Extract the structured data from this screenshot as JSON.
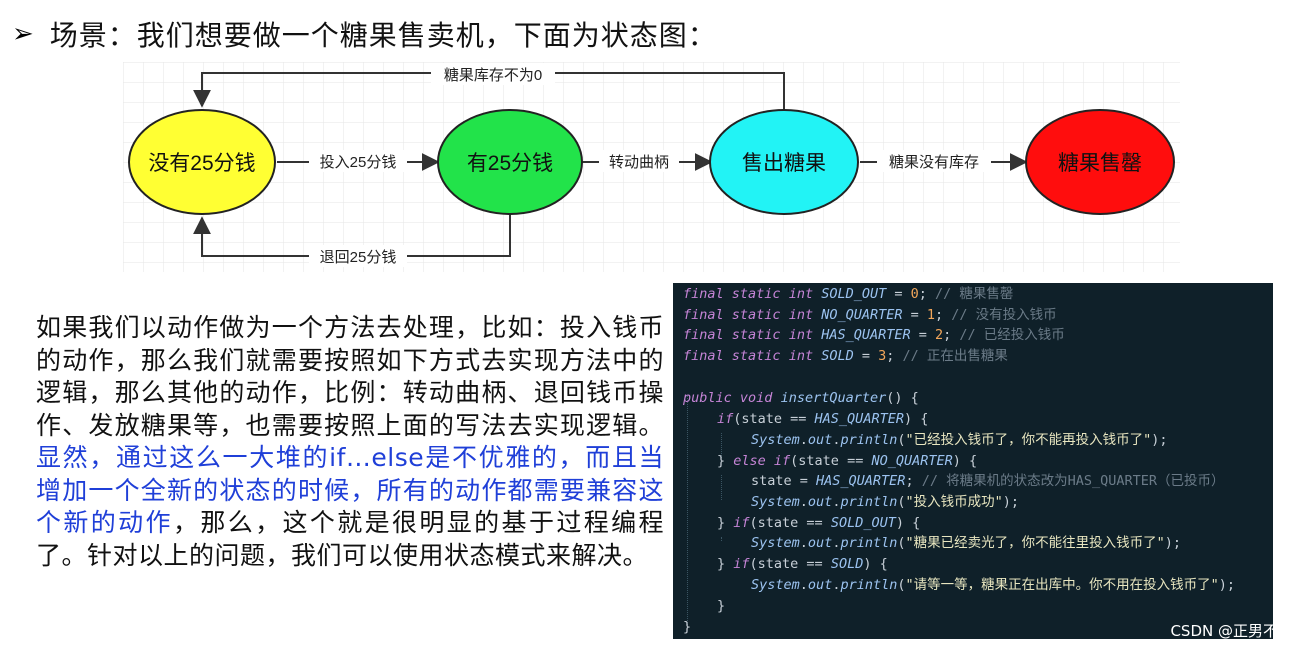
{
  "heading": {
    "bullet": "➢",
    "text": "场景：我们想要做一个糖果售卖机，下面为状态图："
  },
  "diagram": {
    "states": [
      {
        "label": "没有25分钱",
        "fill": "#ffff33"
      },
      {
        "label": "有25分钱",
        "fill": "#22e34a"
      },
      {
        "label": "售出糖果",
        "fill": "#22f3f5"
      },
      {
        "label": "糖果售罄",
        "fill": "#ff0d0d"
      }
    ],
    "transitions": {
      "insert": "投入25分钱",
      "turn": "转动曲柄",
      "sold_out": "糖果没有库存",
      "refund": "退回25分钱",
      "back": "糖果库存不为0"
    }
  },
  "paragraph": {
    "part1": "如果我们以动作做为一个方法去处理，比如：投入钱币的动作，那么我们就需要按照如下方式去实现方法中的逻辑，那么其他的动作，比例：转动曲柄、退回钱币操作、发放糖果等，也需要按照上面的写法去实现逻辑。",
    "highlight": "显然，通过这么一大堆的if…else是不优雅的，而且当增加一个全新的状态的时候，所有的动作都需要兼容这个新的动作",
    "part2": "，那么，这个就是很明显的基于过程编程了。针对以上的问题，我们可以使用状态模式来解决。"
  },
  "code": {
    "line1": {
      "mod": "final static",
      "type": "int",
      "name": "SOLD_OUT",
      "eq": " = ",
      "val": "0",
      "semi": ";",
      "cm": " // 糖果售罄"
    },
    "line2": {
      "mod": "final static",
      "type": "int",
      "name": "NO_QUARTER",
      "eq": " = ",
      "val": "1",
      "semi": ";",
      "cm": " // 没有投入钱币"
    },
    "line3": {
      "mod": "final static",
      "type": "int",
      "name": "HAS_QUARTER",
      "eq": " = ",
      "val": "2",
      "semi": ";",
      "cm": " // 已经投入钱币"
    },
    "line4": {
      "mod": "final static",
      "type": "int",
      "name": "SOLD",
      "eq": " = ",
      "val": "3",
      "semi": ";",
      "cm": " // 正在出售糖果"
    },
    "line5": {
      "mod": "public",
      "type": "void",
      "fn": "insertQuarter",
      "rest": "() {"
    },
    "line6": {
      "kw": "if",
      "open": "(state == ",
      "c": "HAS_QUARTER",
      "close": ") {"
    },
    "line7": {
      "obj": "System",
      "dot1": ".",
      "fld": "out",
      "dot2": ".",
      "fn": "println",
      "open": "(",
      "s": "\"已经投入钱币了，你不能再投入钱币了\"",
      "close": ");"
    },
    "line8": {
      "pre": "} ",
      "kw": "else if",
      "open": "(state == ",
      "c": "NO_QUARTER",
      "close": ") {"
    },
    "line9": {
      "pre": "state = ",
      "c": "HAS_QUARTER",
      "semi": ";",
      "cm": " // 将糖果机的状态改为HAS_QUARTER（已投币）"
    },
    "line10": {
      "obj": "System",
      "dot1": ".",
      "fld": "out",
      "dot2": ".",
      "fn": "println",
      "open": "(",
      "s": "\"投入钱币成功\"",
      "close": ");"
    },
    "line11": {
      "pre": "} ",
      "kw": "if",
      "open": "(state == ",
      "c": "SOLD_OUT",
      "close": ") {"
    },
    "line12": {
      "obj": "System",
      "dot1": ".",
      "fld": "out",
      "dot2": ".",
      "fn": "println",
      "open": "(",
      "s": "\"糖果已经卖光了，你不能往里投入钱币了\"",
      "close": ");"
    },
    "line13": {
      "pre": "} ",
      "kw": "if",
      "open": "(state == ",
      "c": "SOLD",
      "close": ") {"
    },
    "line14": {
      "obj": "System",
      "dot1": ".",
      "fld": "out",
      "dot2": ".",
      "fn": "println",
      "open": "(",
      "s": "\"请等一等，糖果正在出库中。你不用在投入钱币了\"",
      "close": ");"
    },
    "line15": {
      "text": "}"
    },
    "line16": {
      "text": "}"
    }
  },
  "watermark": "CSDN @正男不哭"
}
